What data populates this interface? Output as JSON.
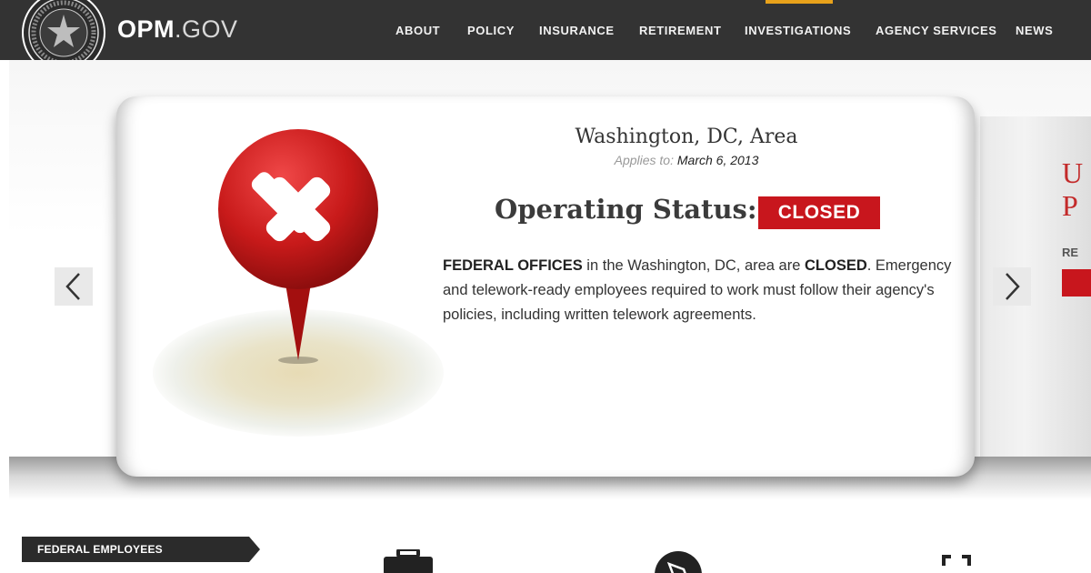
{
  "header": {
    "brand_bold": "OPM",
    "brand_rest": ".GOV",
    "nav": [
      "ABOUT",
      "POLICY",
      "INSURANCE",
      "RETIREMENT",
      "INVESTIGATIONS",
      "AGENCY SERVICES",
      "NEWS"
    ]
  },
  "slide": {
    "location": "Washington, DC, Area",
    "applies_label": "Applies to:",
    "applies_date": "March 6, 2013",
    "status_label": "Operating Status:",
    "status_value": "CLOSED",
    "body_strong_1": "FEDERAL OFFICES",
    "body_1": " in the Washington, DC, area are ",
    "body_strong_2": "CLOSED",
    "body_2": ". Emergency and telework-ready employees required to work must follow their agency's policies, including written telework agreements."
  },
  "next_slide_peek": {
    "letters": [
      "U",
      "P"
    ],
    "label": "RE"
  },
  "sections": {
    "federal_employees": "FEDERAL EMPLOYEES"
  },
  "icons": {
    "prev": "chevron-left-icon",
    "next": "chevron-right-icon",
    "pin": "location-pin-closed-icon",
    "seal": "opm-seal-icon",
    "briefcase": "briefcase-icon",
    "compass": "compass-icon",
    "expand": "expand-icon"
  },
  "colors": {
    "topbar": "#333333",
    "accent_red": "#c8161d",
    "alert_tab": "#e8a21b"
  }
}
